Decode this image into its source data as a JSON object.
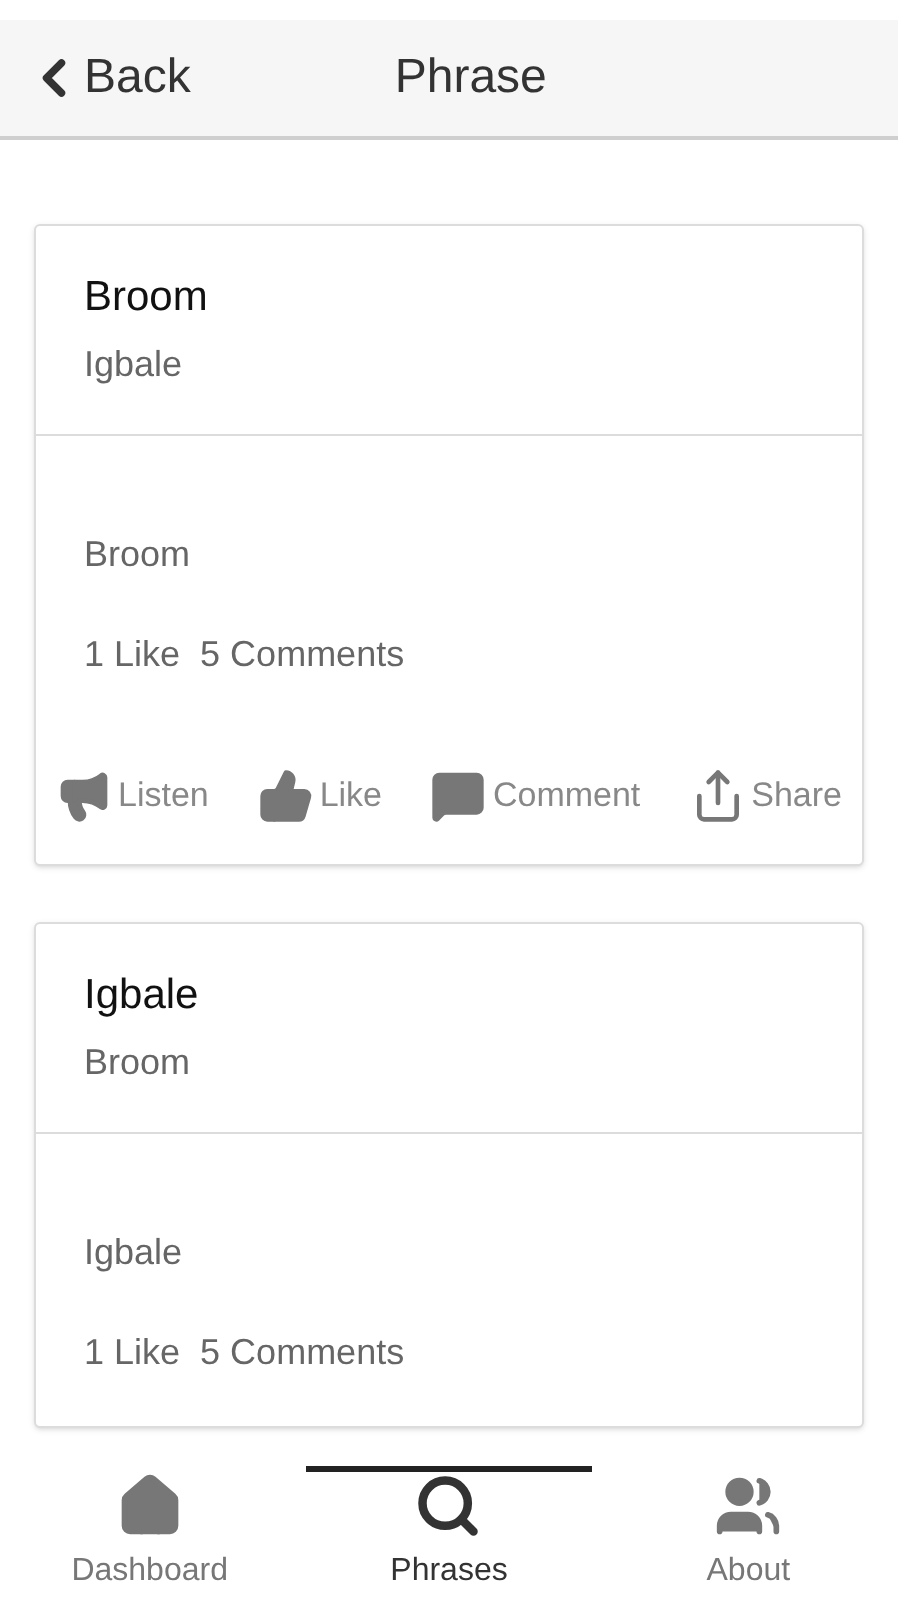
{
  "header": {
    "back": "Back",
    "title": "Phrase"
  },
  "cards": [
    {
      "title": "Broom",
      "subtitle": "Igbale",
      "body": "Broom",
      "likes": "1 Like",
      "comments": "5 Comments",
      "actions": [
        {
          "kind": "listen",
          "label": "Listen"
        },
        {
          "kind": "like",
          "label": "Like"
        },
        {
          "kind": "comment",
          "label": "Comment"
        },
        {
          "kind": "share",
          "label": "Share"
        }
      ]
    },
    {
      "title": "Igbale",
      "subtitle": "Broom",
      "body": "Igbale",
      "likes": "1 Like",
      "comments": "5 Comments"
    }
  ],
  "tabs": [
    {
      "kind": "dashboard",
      "label": "Dashboard",
      "selected": false
    },
    {
      "kind": "phrases",
      "label": "Phrases",
      "selected": true
    },
    {
      "kind": "about",
      "label": "About",
      "selected": false
    }
  ]
}
